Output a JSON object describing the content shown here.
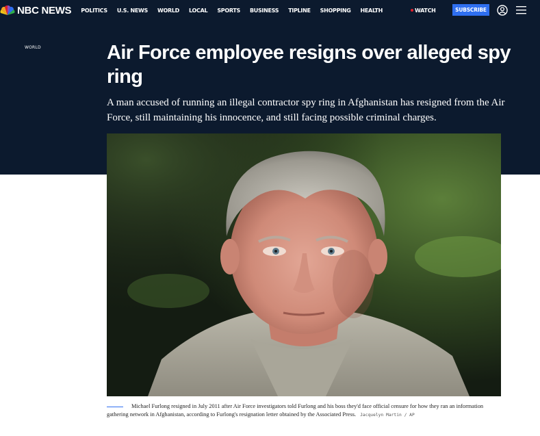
{
  "brand": {
    "logo_text": "NBC NEWS"
  },
  "nav": {
    "items": [
      {
        "label": "POLITICS"
      },
      {
        "label": "U.S. NEWS"
      },
      {
        "label": "WORLD"
      },
      {
        "label": "LOCAL"
      },
      {
        "label": "SPORTS"
      },
      {
        "label": "BUSINESS"
      },
      {
        "label": "TIPLINE"
      },
      {
        "label": "SHOPPING"
      },
      {
        "label": "HEALTH"
      }
    ],
    "watch_label": "WATCH",
    "subscribe_label": "SUBSCRIBE",
    "account_icon": "account-icon",
    "menu_icon": "menu-icon"
  },
  "article": {
    "section": "WORLD",
    "headline": "Air Force employee resigns over alleged spy ring",
    "dek": "A man accused of running an illegal contractor spy ring in Afghanistan has resigned from the Air Force, still maintaining his innocence, and still facing possible criminal charges.",
    "caption": "Michael Furlong resigned in July 2011 after Air Force investigators told Furlong and his boss they'd face official censure for how they ran an information gathering network in Afghanistan, according to Furlong's resignation letter obtained by the Associated Press.",
    "credit": "Jacquelyn Martin / AP"
  },
  "colors": {
    "nav_bg": "#0c1a2e",
    "subscribe_bg": "#2f6ff0",
    "watch_dot": "#e0202c",
    "caption_rule": "#2f6ff0"
  }
}
